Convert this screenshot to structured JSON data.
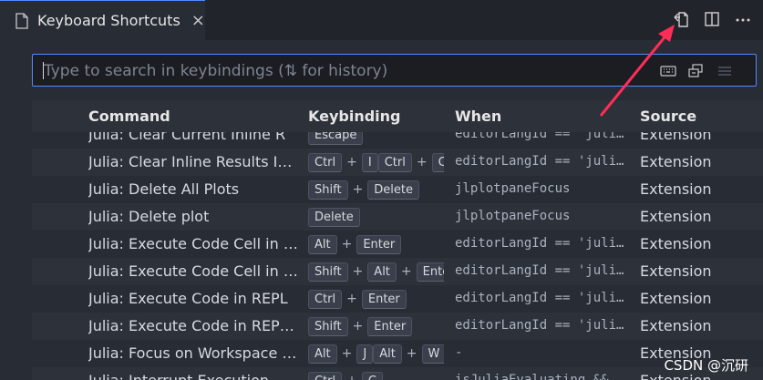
{
  "tab": {
    "title": "Keyboard Shortcuts",
    "close": "×"
  },
  "search": {
    "placeholder": "Type to search in keybindings (⇅ for history)"
  },
  "columns": {
    "command": "Command",
    "keybinding": "Keybinding",
    "when": "When",
    "source": "Source"
  },
  "rows": [
    {
      "command": "Julia: Clear Current Inline R",
      "keys": [
        [
          "Escape"
        ]
      ],
      "when": "editorLangId == 'julia'",
      "source": "Extension"
    },
    {
      "command": "Julia: Clear Inline Results In Editor",
      "keys": [
        [
          "Ctrl",
          "I"
        ],
        [
          "Ctrl",
          "C"
        ]
      ],
      "when": "editorLangId == 'julia'",
      "source": "Extension"
    },
    {
      "command": "Julia: Delete All Plots",
      "keys": [
        [
          "Shift",
          "Delete"
        ]
      ],
      "when": "jlplotpaneFocus",
      "source": "Extension"
    },
    {
      "command": "Julia: Delete plot",
      "keys": [
        [
          "Delete"
        ]
      ],
      "when": "jlplotpaneFocus",
      "source": "Extension"
    },
    {
      "command": "Julia: Execute Code Cell in REPL",
      "keys": [
        [
          "Alt",
          "Enter"
        ]
      ],
      "when": "editorLangId == 'julia'",
      "source": "Extension"
    },
    {
      "command": "Julia: Execute Code Cell in REPL and Move",
      "keys": [
        [
          "Shift",
          "Alt",
          "Enter"
        ]
      ],
      "when": "editorLangId == 'julia'",
      "source": "Extension"
    },
    {
      "command": "Julia: Execute Code in REPL",
      "keys": [
        [
          "Ctrl",
          "Enter"
        ]
      ],
      "when": "editorLangId == 'julia'",
      "source": "Extension"
    },
    {
      "command": "Julia: Execute Code in REPL and Move",
      "keys": [
        [
          "Shift",
          "Enter"
        ]
      ],
      "when": "editorLangId == 'julia'",
      "source": "Extension"
    },
    {
      "command": "Julia: Focus on Workspace View",
      "keys": [
        [
          "Alt",
          "J"
        ],
        [
          "Alt",
          "W"
        ]
      ],
      "when": "-",
      "source": "Extension"
    },
    {
      "command": "Julia: Interrupt Execution",
      "keys": [
        [
          "Ctrl",
          "C"
        ]
      ],
      "when": "isJuliaEvaluating && ...",
      "source": "Extension"
    }
  ],
  "watermark": "CSDN @沉研",
  "colors": {
    "accent": "#528bff",
    "arrow": "#ff2d55"
  }
}
